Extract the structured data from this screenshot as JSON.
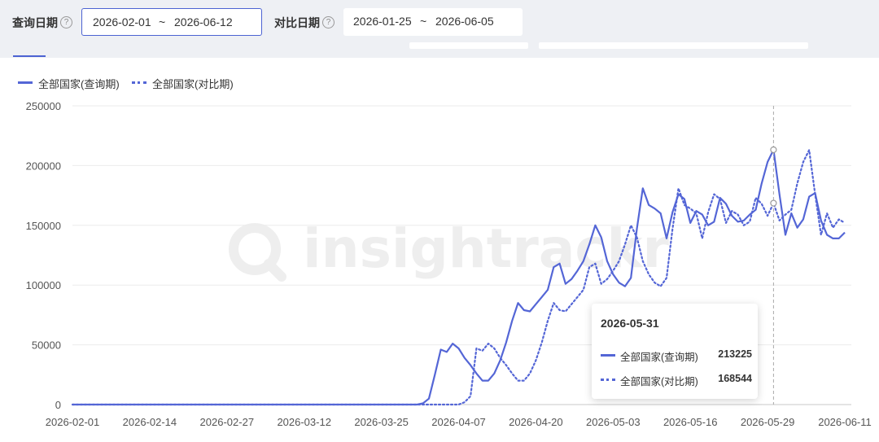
{
  "filters": {
    "query_label": "查询日期",
    "query_start": "2026-02-01",
    "query_sep": "~",
    "query_end": "2026-06-12",
    "compare_label": "对比日期",
    "compare_start": "2026-01-25",
    "compare_sep": "~",
    "compare_end": "2026-06-05",
    "help_glyph": "?"
  },
  "colors": {
    "series": "#5466d6",
    "grid": "#ebebeb",
    "axis_text": "#555555"
  },
  "watermark": "insightrackr",
  "chart_data": {
    "type": "line",
    "xlabel": "",
    "ylabel": "",
    "ylim": [
      0,
      250000
    ],
    "yticks": [
      0,
      50000,
      100000,
      150000,
      200000,
      250000
    ],
    "x_start": "2026-02-01",
    "x_tick_labels": [
      "2026-02-01",
      "2026-02-14",
      "2026-02-27",
      "2026-03-12",
      "2026-03-25",
      "2026-04-07",
      "2026-04-20",
      "2026-05-03",
      "2026-05-16",
      "2026-05-29",
      "2026-06-11"
    ],
    "grid": true,
    "legend_position": "top-left",
    "series": [
      {
        "name": "全部国家(查询期)",
        "style": "solid",
        "points": [
          [
            "2026-02-01",
            0
          ],
          [
            "2026-03-31",
            0
          ],
          [
            "2026-04-01",
            1000
          ],
          [
            "2026-04-02",
            5000
          ],
          [
            "2026-04-03",
            25000
          ],
          [
            "2026-04-04",
            46000
          ],
          [
            "2026-04-05",
            44000
          ],
          [
            "2026-04-06",
            51000
          ],
          [
            "2026-04-07",
            47000
          ],
          [
            "2026-04-08",
            39000
          ],
          [
            "2026-04-09",
            33000
          ],
          [
            "2026-04-10",
            26000
          ],
          [
            "2026-04-11",
            20000
          ],
          [
            "2026-04-12",
            20000
          ],
          [
            "2026-04-13",
            26000
          ],
          [
            "2026-04-14",
            37000
          ],
          [
            "2026-04-15",
            52000
          ],
          [
            "2026-04-16",
            70000
          ],
          [
            "2026-04-17",
            85000
          ],
          [
            "2026-04-18",
            79000
          ],
          [
            "2026-04-19",
            78000
          ],
          [
            "2026-04-20",
            84000
          ],
          [
            "2026-04-21",
            90000
          ],
          [
            "2026-04-22",
            96000
          ],
          [
            "2026-04-23",
            115000
          ],
          [
            "2026-04-24",
            118000
          ],
          [
            "2026-04-25",
            101000
          ],
          [
            "2026-04-26",
            105000
          ],
          [
            "2026-04-27",
            112000
          ],
          [
            "2026-04-28",
            120000
          ],
          [
            "2026-04-29",
            134000
          ],
          [
            "2026-04-30",
            150000
          ],
          [
            "2026-05-01",
            140000
          ],
          [
            "2026-05-02",
            120000
          ],
          [
            "2026-05-03",
            109000
          ],
          [
            "2026-05-04",
            102000
          ],
          [
            "2026-05-05",
            99000
          ],
          [
            "2026-05-06",
            106000
          ],
          [
            "2026-05-07",
            147000
          ],
          [
            "2026-05-08",
            181000
          ],
          [
            "2026-05-09",
            167000
          ],
          [
            "2026-05-10",
            164000
          ],
          [
            "2026-05-11",
            160000
          ],
          [
            "2026-05-12",
            139000
          ],
          [
            "2026-05-13",
            161000
          ],
          [
            "2026-05-14",
            176000
          ],
          [
            "2026-05-15",
            172000
          ],
          [
            "2026-05-16",
            152000
          ],
          [
            "2026-05-17",
            162000
          ],
          [
            "2026-05-18",
            159000
          ],
          [
            "2026-05-19",
            150000
          ],
          [
            "2026-05-20",
            153000
          ],
          [
            "2026-05-21",
            173000
          ],
          [
            "2026-05-22",
            168000
          ],
          [
            "2026-05-23",
            158000
          ],
          [
            "2026-05-24",
            153000
          ],
          [
            "2026-05-25",
            154000
          ],
          [
            "2026-05-26",
            159000
          ],
          [
            "2026-05-27",
            163000
          ],
          [
            "2026-05-28",
            185000
          ],
          [
            "2026-05-29",
            203000
          ],
          [
            "2026-05-30",
            213225
          ],
          [
            "2026-05-31",
            176000
          ],
          [
            "2026-06-01",
            142000
          ],
          [
            "2026-06-02",
            160000
          ],
          [
            "2026-06-03",
            148000
          ],
          [
            "2026-06-04",
            155000
          ],
          [
            "2026-06-05",
            174000
          ],
          [
            "2026-06-06",
            177000
          ],
          [
            "2026-06-07",
            154000
          ],
          [
            "2026-06-08",
            142000
          ],
          [
            "2026-06-09",
            139000
          ],
          [
            "2026-06-10",
            139000
          ],
          [
            "2026-06-11",
            144000
          ]
        ]
      },
      {
        "name": "全部国家(对比期)",
        "style": "dotted",
        "points": [
          [
            "2026-02-01",
            0
          ],
          [
            "2026-04-05",
            0
          ],
          [
            "2026-04-07",
            0
          ],
          [
            "2026-04-08",
            2000
          ],
          [
            "2026-04-09",
            7000
          ],
          [
            "2026-04-10",
            47000
          ],
          [
            "2026-04-11",
            45000
          ],
          [
            "2026-04-12",
            51000
          ],
          [
            "2026-04-13",
            47000
          ],
          [
            "2026-04-14",
            39000
          ],
          [
            "2026-04-15",
            33000
          ],
          [
            "2026-04-16",
            26000
          ],
          [
            "2026-04-17",
            20000
          ],
          [
            "2026-04-18",
            20000
          ],
          [
            "2026-04-19",
            26000
          ],
          [
            "2026-04-20",
            37000
          ],
          [
            "2026-04-21",
            52000
          ],
          [
            "2026-04-22",
            70000
          ],
          [
            "2026-04-23",
            85000
          ],
          [
            "2026-04-24",
            79000
          ],
          [
            "2026-04-25",
            78000
          ],
          [
            "2026-04-26",
            84000
          ],
          [
            "2026-04-27",
            90000
          ],
          [
            "2026-04-28",
            96000
          ],
          [
            "2026-04-29",
            115000
          ],
          [
            "2026-04-30",
            118000
          ],
          [
            "2026-05-01",
            101000
          ],
          [
            "2026-05-02",
            105000
          ],
          [
            "2026-05-03",
            112000
          ],
          [
            "2026-05-04",
            120000
          ],
          [
            "2026-05-05",
            134000
          ],
          [
            "2026-05-06",
            150000
          ],
          [
            "2026-05-07",
            140000
          ],
          [
            "2026-05-08",
            120000
          ],
          [
            "2026-05-09",
            109000
          ],
          [
            "2026-05-10",
            102000
          ],
          [
            "2026-05-11",
            99000
          ],
          [
            "2026-05-12",
            106000
          ],
          [
            "2026-05-13",
            147000
          ],
          [
            "2026-05-14",
            181000
          ],
          [
            "2026-05-15",
            167000
          ],
          [
            "2026-05-16",
            164000
          ],
          [
            "2026-05-17",
            160000
          ],
          [
            "2026-05-18",
            139000
          ],
          [
            "2026-05-19",
            161000
          ],
          [
            "2026-05-20",
            176000
          ],
          [
            "2026-05-21",
            172000
          ],
          [
            "2026-05-22",
            152000
          ],
          [
            "2026-05-23",
            162000
          ],
          [
            "2026-05-24",
            159000
          ],
          [
            "2026-05-25",
            150000
          ],
          [
            "2026-05-26",
            153000
          ],
          [
            "2026-05-27",
            173000
          ],
          [
            "2026-05-28",
            168000
          ],
          [
            "2026-05-29",
            158000
          ],
          [
            "2026-05-30",
            168544
          ],
          [
            "2026-05-31",
            154000
          ],
          [
            "2026-06-01",
            159000
          ],
          [
            "2026-06-02",
            163000
          ],
          [
            "2026-06-03",
            185000
          ],
          [
            "2026-06-04",
            203000
          ],
          [
            "2026-06-05",
            213000
          ],
          [
            "2026-06-06",
            176000
          ],
          [
            "2026-06-07",
            142000
          ],
          [
            "2026-06-08",
            160000
          ],
          [
            "2026-06-09",
            148000
          ],
          [
            "2026-06-10",
            155000
          ],
          [
            "2026-06-11",
            152000
          ]
        ]
      }
    ],
    "tooltip": {
      "date": "2026-05-31",
      "hover_x": "2026-05-30",
      "rows": [
        {
          "name": "全部国家(查询期)",
          "value": "213225",
          "style": "solid"
        },
        {
          "name": "全部国家(对比期)",
          "value": "168544",
          "style": "dotted"
        }
      ]
    }
  }
}
